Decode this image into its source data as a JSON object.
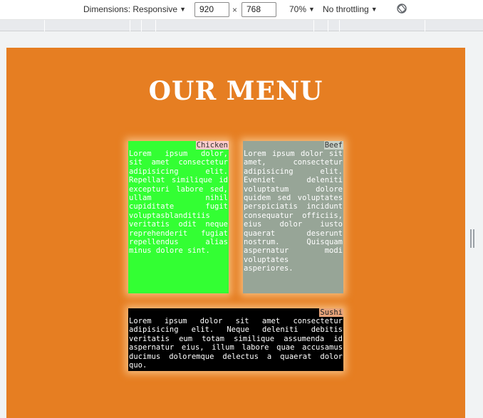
{
  "devtools": {
    "dimensions_label": "Dimensions: Responsive",
    "width": "920",
    "height": "768",
    "times": "×",
    "zoom": "70%",
    "throttling": "No throttling",
    "caret": "▼",
    "rotate_icon": "rotate-icon"
  },
  "page": {
    "title": "OUR MENU",
    "items": [
      {
        "name": "Chicken",
        "text": "Lorem ipsum dolor, sit amet consectetur adipisicing elit. Repellat similique id excepturi labore sed, ullam nihil cupiditate fugit voluptasblanditiis veritatis odit neque reprehenderit fugiat repellendus alias minus dolore sint.",
        "color": "#33ff33"
      },
      {
        "name": "Beef",
        "text": "Lorem ipsum dolor sit amet, consectetur adipisicing elit. Eveniet deleniti voluptatum dolore quidem sed voluptates perspiciatis incidunt consequatur officiis, eius dolor iusto quaerat deserunt nostrum. Quisquam aspernatur modi voluptates asperiores.",
        "color": "#97a597"
      },
      {
        "name": "Sushi",
        "text": "Lorem ipsum dolor sit amet consectetur adipisicing elit. Neque deleniti debitis veritatis eum totam similique assumenda id aspernatur eius, illum labore quae accusamus ducimus doloremque delectus a quaerat dolor quo.",
        "color": "#000000"
      }
    ]
  }
}
